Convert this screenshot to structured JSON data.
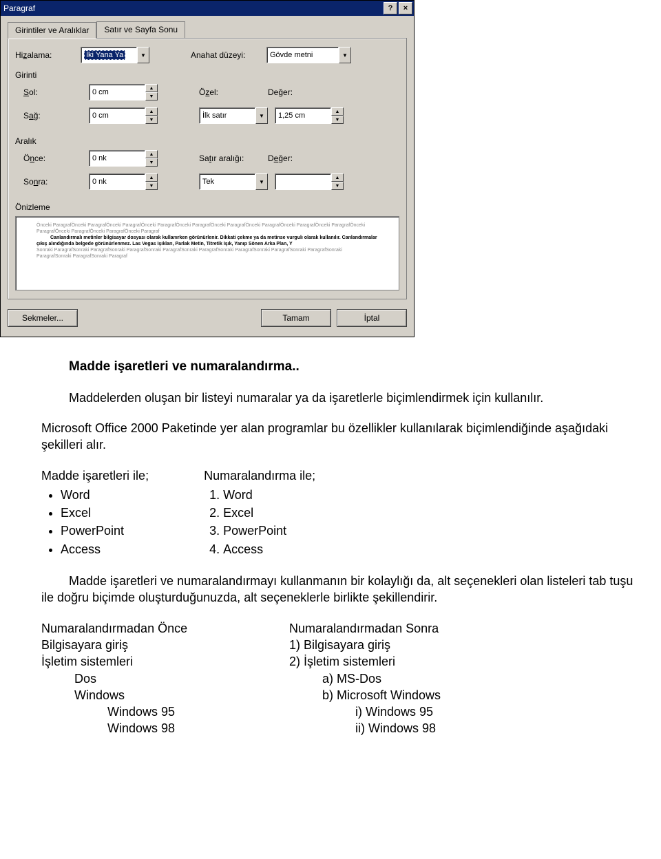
{
  "dialog": {
    "title": "Paragraf",
    "tabs": [
      "Girintiler ve Aralıklar",
      "Satır ve Sayfa Sonu"
    ],
    "alignment_label": "Hizalama:",
    "alignment_value": "İki Yana Ya",
    "outline_label": "Anahat düzeyi:",
    "outline_value": "Gövde metni",
    "indent_group": "Girinti",
    "left_label": "Sol:",
    "left_value": "0 cm",
    "right_label": "Sağ:",
    "right_value": "0 cm",
    "special_label": "Özel:",
    "special_value": "İlk satır",
    "by_label": "Değer:",
    "by_value": "1,25 cm",
    "spacing_group": "Aralık",
    "before_label": "Önce:",
    "before_value": "0 nk",
    "after_label": "Sonra:",
    "after_value": "0 nk",
    "linespacing_label": "Satır aralığı:",
    "linespacing_value": "Tek",
    "at_label": "Değer:",
    "at_value": "",
    "preview_group": "Önizleme",
    "preview_light1": "Önceki ParagrafÖnceki ParagrafÖnceki ParagrafÖnceki ParagrafÖnceki ParagrafÖnceki ParagrafÖnceki ParagrafÖnceki ParagrafÖnceki ParagrafÖnceki ParagrafÖnceki ParagrafÖnceki ParagrafÖnceki Paragraf",
    "preview_bold": "Canlandırmalı metinler bilgisayar dosyası olarak kullanırken görünürlenir. Dikkati çekme ya da metinse vurgulı olarak kullanılır. Canlandırmalar çıkış alındığında belgede görünürlenmez. Las Vegas Işıkları, Parlak Metin, Titretik Işık, Yanıp Sönen Arka Plan, Y",
    "preview_light2": "Sonraki ParagrafSonraki ParagrafSonraki ParagrafSonraki ParagrafSonraki ParagrafSonraki ParagrafSonraki ParagrafSonraki ParagrafSonraki ParagrafSonraki ParagrafSonraki Paragraf",
    "tabs_btn": "Sekmeler...",
    "ok_btn": "Tamam",
    "cancel_btn": "İptal"
  },
  "doc": {
    "heading": "Madde işaretleri ve numaralandırma..",
    "p1": "Maddelerden oluşan bir listeyi numaralar ya da işaretlerle biçimlendirmek için kullanılır.",
    "p2": "Microsoft Office 2000 Paketinde yer alan programlar bu özellikler kullanılarak biçimlendiğinde aşağıdaki şekilleri alır.",
    "bullets_title": "Madde işaretleri ile;",
    "bullets": [
      "Word",
      "Excel",
      "PowerPoint",
      "Access"
    ],
    "numbers_title": "Numaralandırma ile;",
    "numbers": [
      "Word",
      "Excel",
      "PowerPoint",
      "Access"
    ],
    "p3": "Madde işaretleri ve numaralandırmayı kullanmanın bir kolaylığı da, alt seçenekleri olan listeleri tab tuşu ile doğru biçimde oluşturduğunuzda, alt seçeneklerle birlikte şekillendirir.",
    "before_hdr": "Numaralandırmadan Önce",
    "after_hdr": "Numaralandırmadan Sonra",
    "before_items": [
      {
        "lvl": 0,
        "txt": "Bilgisayara giriş"
      },
      {
        "lvl": 0,
        "txt": "İşletim sistemleri"
      },
      {
        "lvl": 1,
        "txt": "Dos"
      },
      {
        "lvl": 1,
        "txt": "Windows"
      },
      {
        "lvl": 2,
        "txt": "Windows 95"
      },
      {
        "lvl": 2,
        "txt": "Windows 98"
      }
    ],
    "after_items": [
      {
        "lvl": 0,
        "txt": "1)  Bilgisayara giriş"
      },
      {
        "lvl": 0,
        "txt": "2)  İşletim sistemleri"
      },
      {
        "lvl": 1,
        "txt": "a)  MS-Dos"
      },
      {
        "lvl": 1,
        "txt": "b)  Microsoft Windows"
      },
      {
        "lvl": 2,
        "txt": "i)  Windows 95"
      },
      {
        "lvl": 2,
        "txt": "ii)  Windows 98"
      }
    ]
  }
}
